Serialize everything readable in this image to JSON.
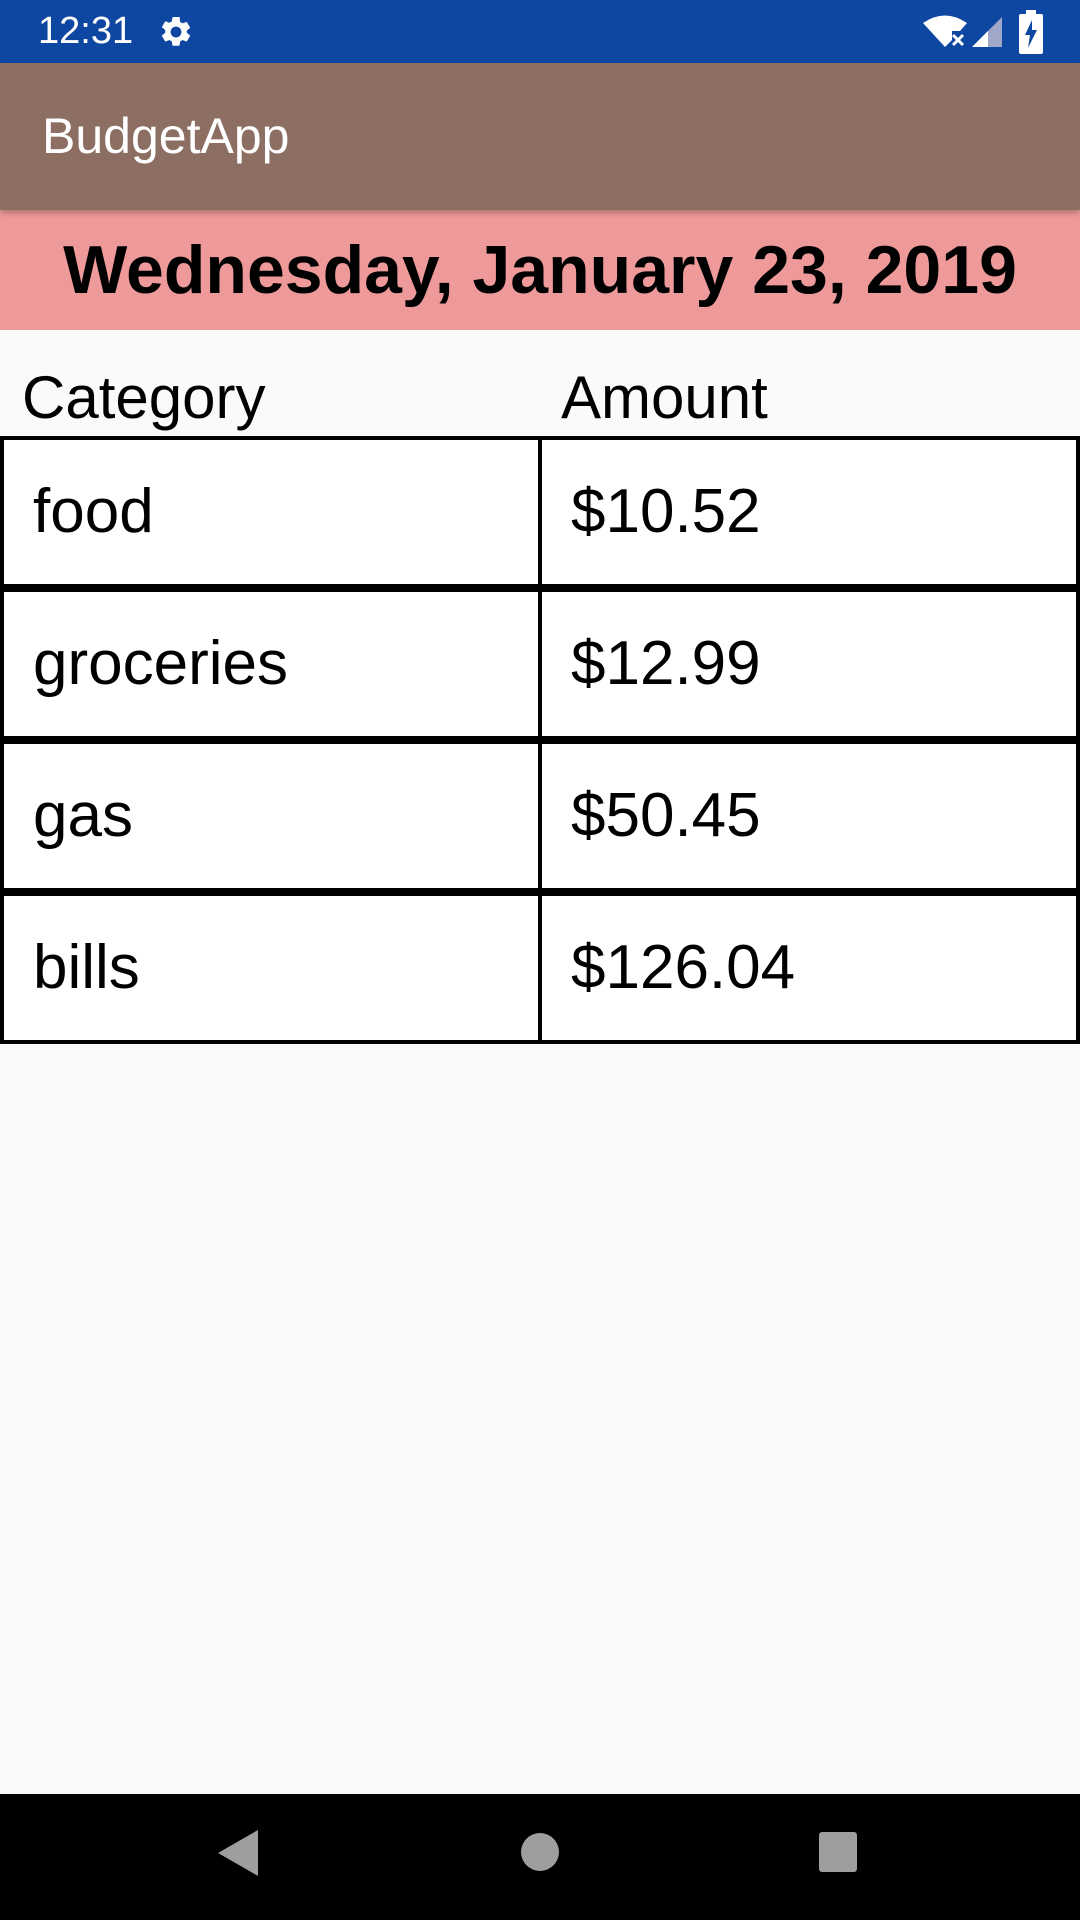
{
  "status_bar": {
    "time": "12:31",
    "icons": [
      "gear-icon",
      "wifi-off-icon",
      "cell-signal-icon",
      "battery-charging-icon"
    ]
  },
  "app_bar": {
    "title": "BudgetApp",
    "color": "#8d6e63"
  },
  "date_banner": {
    "text": "Wednesday, January 23, 2019",
    "color": "#ef9a9a"
  },
  "table": {
    "headers": [
      "Category",
      "Amount"
    ],
    "rows": [
      {
        "category": "food",
        "amount": "$10.52"
      },
      {
        "category": "groceries",
        "amount": "$12.99"
      },
      {
        "category": "gas",
        "amount": "$50.45"
      },
      {
        "category": "bills",
        "amount": "$126.04"
      }
    ]
  },
  "nav_bar": {
    "icons": [
      "back-icon",
      "home-icon",
      "recents-icon"
    ]
  },
  "colors": {
    "status_bar": "#0d47a1",
    "background": "#fafafa",
    "nav_bar": "#000000"
  }
}
